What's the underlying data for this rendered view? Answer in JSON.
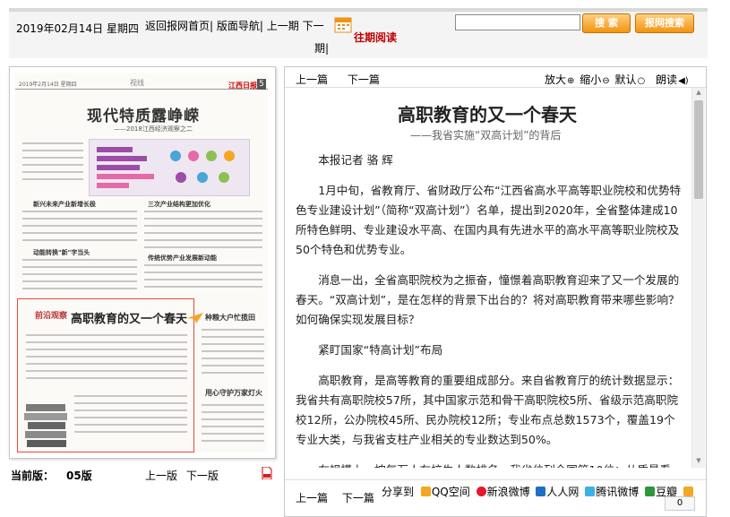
{
  "header": {
    "date": "2019年02月14日  星期四",
    "nav": [
      "返回报网首页|",
      "版面导航|",
      "上一期",
      "下一期|"
    ],
    "past_issues": "往期阅读",
    "search_placeholder": "",
    "search_button": "搜 索",
    "full_search_button": "报网搜索"
  },
  "thumbnail": {
    "section": "视线",
    "page_num": "5",
    "logo": "江西日报",
    "headline": "现代特质露峥嵘",
    "subline": "——2018江西经济观察之二",
    "small_heads": [
      "新兴未来产业新增长极",
      "三次产业结构更加优化",
      "动能转换\"新\"字当头",
      "传统优势产业发展新动能"
    ],
    "lower_badge": "前沿观察",
    "lower_title": "高职教育的又一个春天",
    "right_heads": [
      "种粮大户忙揽田",
      "用心守护万家灯火"
    ]
  },
  "page_footer": {
    "current_label": "当前版：",
    "current_value": "05版",
    "prev": "上一版",
    "next": "下一版"
  },
  "toolbar": {
    "prev": "上一篇",
    "next": "下一篇",
    "zoom_in": "放大",
    "zoom_out": "缩小",
    "default": "默认",
    "read": "朗读"
  },
  "article": {
    "title": "高职教育的又一个春天",
    "subtitle": "——我省实施“双高计划”的背后",
    "byline": "本报记者 骆 辉",
    "paragraphs": [
      "1月中旬，省教育厅、省财政厅公布“江西省高水平高等职业院校和优势特色专业建设计划”（简称“双高计划”）名单，提出到2020年，全省整体建成10所特色鲜明、专业建设水平高、在国内具有先进水平的高水平高等职业院校及50个特色和优势专业。",
      "消息一出，全省高职院校为之振奋，憧憬着高职教育迎来了又一个发展的春天。“双高计划”，是在怎样的背景下出台的？将对高职教育带来哪些影响？如何确保实现发展目标？",
      "紧盯国家“特高计划”布局",
      "高职教育，是高等教育的重要组成部分。来自省教育厅的统计数据显示：我省共有高职院校57所，其中国家示范和骨干高职院校5所、省级示范高职院校12所，公办院校45所、民办院校12所；专业布点总数1573个，覆盖19个专业大类，与我省支柱产业相关的专业数达到50%。",
      "在规模上，按每万人在校生人数排名，我省位列全国第10位；从质量看，学生技能大赛、教师教学能力大赛、教学成果奖获奖数量逐年增加，在全国处于"
    ]
  },
  "footer": {
    "prev": "上一篇",
    "next": "下一篇",
    "share_label": "分享到",
    "share": [
      "QQ空间",
      "新浪微博",
      "人人网",
      "腾讯微博",
      "豆瓣"
    ],
    "count": "0"
  },
  "colors": {
    "accent_red": "#c00000",
    "button_orange": "#f29410",
    "qq": "#f5a623",
    "weibo": "#e6162d",
    "renren": "#1f6fc5",
    "tqq": "#3ab1e7",
    "douban": "#2e963d"
  }
}
